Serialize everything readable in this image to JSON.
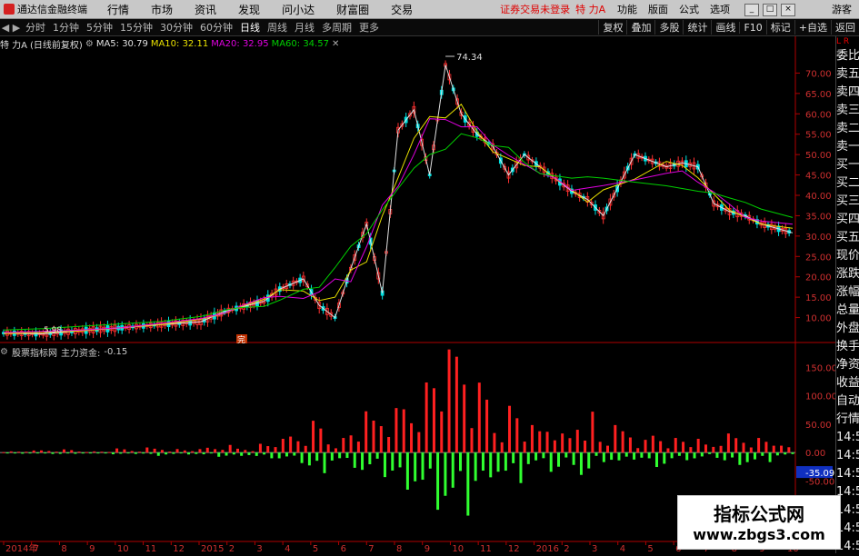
{
  "titlebar": {
    "app_name": "通达信金融终端",
    "menu": [
      "行情",
      "市场",
      "资讯",
      "发现",
      "问小达",
      "财富圈",
      "交易"
    ],
    "status": "证券交易未登录",
    "stock_title": "特 力A",
    "tools": [
      "功能",
      "版面",
      "公式",
      "选项"
    ],
    "guest": "游客"
  },
  "toolbar": {
    "periods": [
      "分时",
      "1分钟",
      "5分钟",
      "15分钟",
      "30分钟",
      "60分钟",
      "日线",
      "周线",
      "月线",
      "多周期",
      "更多"
    ],
    "active_period": "日线",
    "right": [
      "复权",
      "叠加",
      "多股",
      "统计",
      "画线",
      "F10",
      "标记",
      "+自选",
      "返回"
    ]
  },
  "ma_line": {
    "name": "特 力A",
    "mode": "(日线前复权)",
    "ma5": "MA5: 30.79",
    "ma10": "MA10: 32.11",
    "ma20": "MA20: 32.95",
    "ma60": "MA60: 34.57",
    "colors": {
      "ma5": "#e0e0e0",
      "ma10": "#e8e000",
      "ma20": "#e000e0",
      "ma60": "#00d000"
    }
  },
  "indicator_line": {
    "name": "股票指标网",
    "label": "主力资金:",
    "value": "-0.15"
  },
  "price_axis": [
    "70.00",
    "65.00",
    "60.00",
    "55.00",
    "50.00",
    "45.00",
    "40.00",
    "35.00",
    "30.00",
    "25.00",
    "20.00",
    "15.00",
    "10.00"
  ],
  "ind_axis": [
    "150.00",
    "100.00",
    "50.00",
    "0.00",
    "-35.09",
    "-50.00",
    "-100.00"
  ],
  "annotations": {
    "high": "74.34",
    "low": "5.98",
    "marker": "完"
  },
  "x_axis": [
    "2014年",
    "7",
    "8",
    "9",
    "10",
    "11",
    "12",
    "2015",
    "2",
    "3",
    "4",
    "5",
    "6",
    "7",
    "8",
    "9",
    "10",
    "11",
    "12",
    "2016",
    "2",
    "3",
    "4",
    "5",
    "6",
    "7",
    "8",
    "9",
    "10"
  ],
  "side_panel": {
    "top": "L R",
    "items": [
      "委比",
      "卖五",
      "卖四",
      "卖三",
      "卖二",
      "卖一",
      "买一",
      "买二",
      "买三",
      "买四",
      "买五",
      "现价",
      "涨跌",
      "涨幅",
      "总量",
      "外盘",
      "换手",
      "净资",
      "收益",
      "自动",
      "行情",
      "14:55",
      "14:56",
      "14:56",
      "14:56",
      "14:56",
      "14:56",
      "14:56"
    ]
  },
  "watermark": {
    "line1": "指标公式网",
    "line2": "www.zbgs3.com"
  },
  "chart_data": [
    {
      "type": "line",
      "title": "特 力A (日线前复权)",
      "ylim": [
        5,
        75
      ],
      "series": [
        {
          "name": "price",
          "x": [
            0,
            0.05,
            0.1,
            0.15,
            0.2,
            0.25,
            0.28,
            0.3,
            0.33,
            0.35,
            0.38,
            0.4,
            0.42,
            0.44,
            0.46,
            0.48,
            0.5,
            0.52,
            0.54,
            0.56,
            0.58,
            0.6,
            0.62,
            0.64,
            0.66,
            0.68,
            0.7,
            0.72,
            0.74,
            0.76,
            0.8,
            0.84,
            0.86,
            0.88,
            0.9,
            0.92,
            0.94,
            0.96,
            1.0
          ],
          "values": [
            6.2,
            6.0,
            6.8,
            7.5,
            8.3,
            9.0,
            11.5,
            12.5,
            14.0,
            17.0,
            19.5,
            13.0,
            10.0,
            22.0,
            33.0,
            16.0,
            56.0,
            61.0,
            45.0,
            72.0,
            60.0,
            55.0,
            52.0,
            45.0,
            50.0,
            47.0,
            44.0,
            41.0,
            39.0,
            35.0,
            50.0,
            47.0,
            48.0,
            47.0,
            38.0,
            36.0,
            35.0,
            33.0,
            30.8
          ]
        }
      ],
      "annotations": [
        {
          "label": "74.34",
          "type": "high"
        },
        {
          "label": "5.98",
          "type": "low"
        }
      ]
    },
    {
      "type": "bar",
      "title": "主力资金",
      "ylim": [
        -150,
        160
      ],
      "series": [
        {
          "name": "主力资金",
          "values": [
            2,
            -3,
            4,
            -5,
            3,
            -2,
            6,
            -4,
            8,
            -6,
            5,
            -9,
            12,
            -8,
            15,
            -20,
            30,
            -50,
            25,
            -40,
            60,
            -70,
            90,
            -120,
            150,
            -180,
            110,
            -60,
            80,
            -40,
            55,
            -30,
            70,
            -25,
            40,
            -20,
            35,
            -25,
            20,
            -15,
            30,
            -30,
            25,
            -10,
            -15
          ]
        }
      ]
    }
  ]
}
